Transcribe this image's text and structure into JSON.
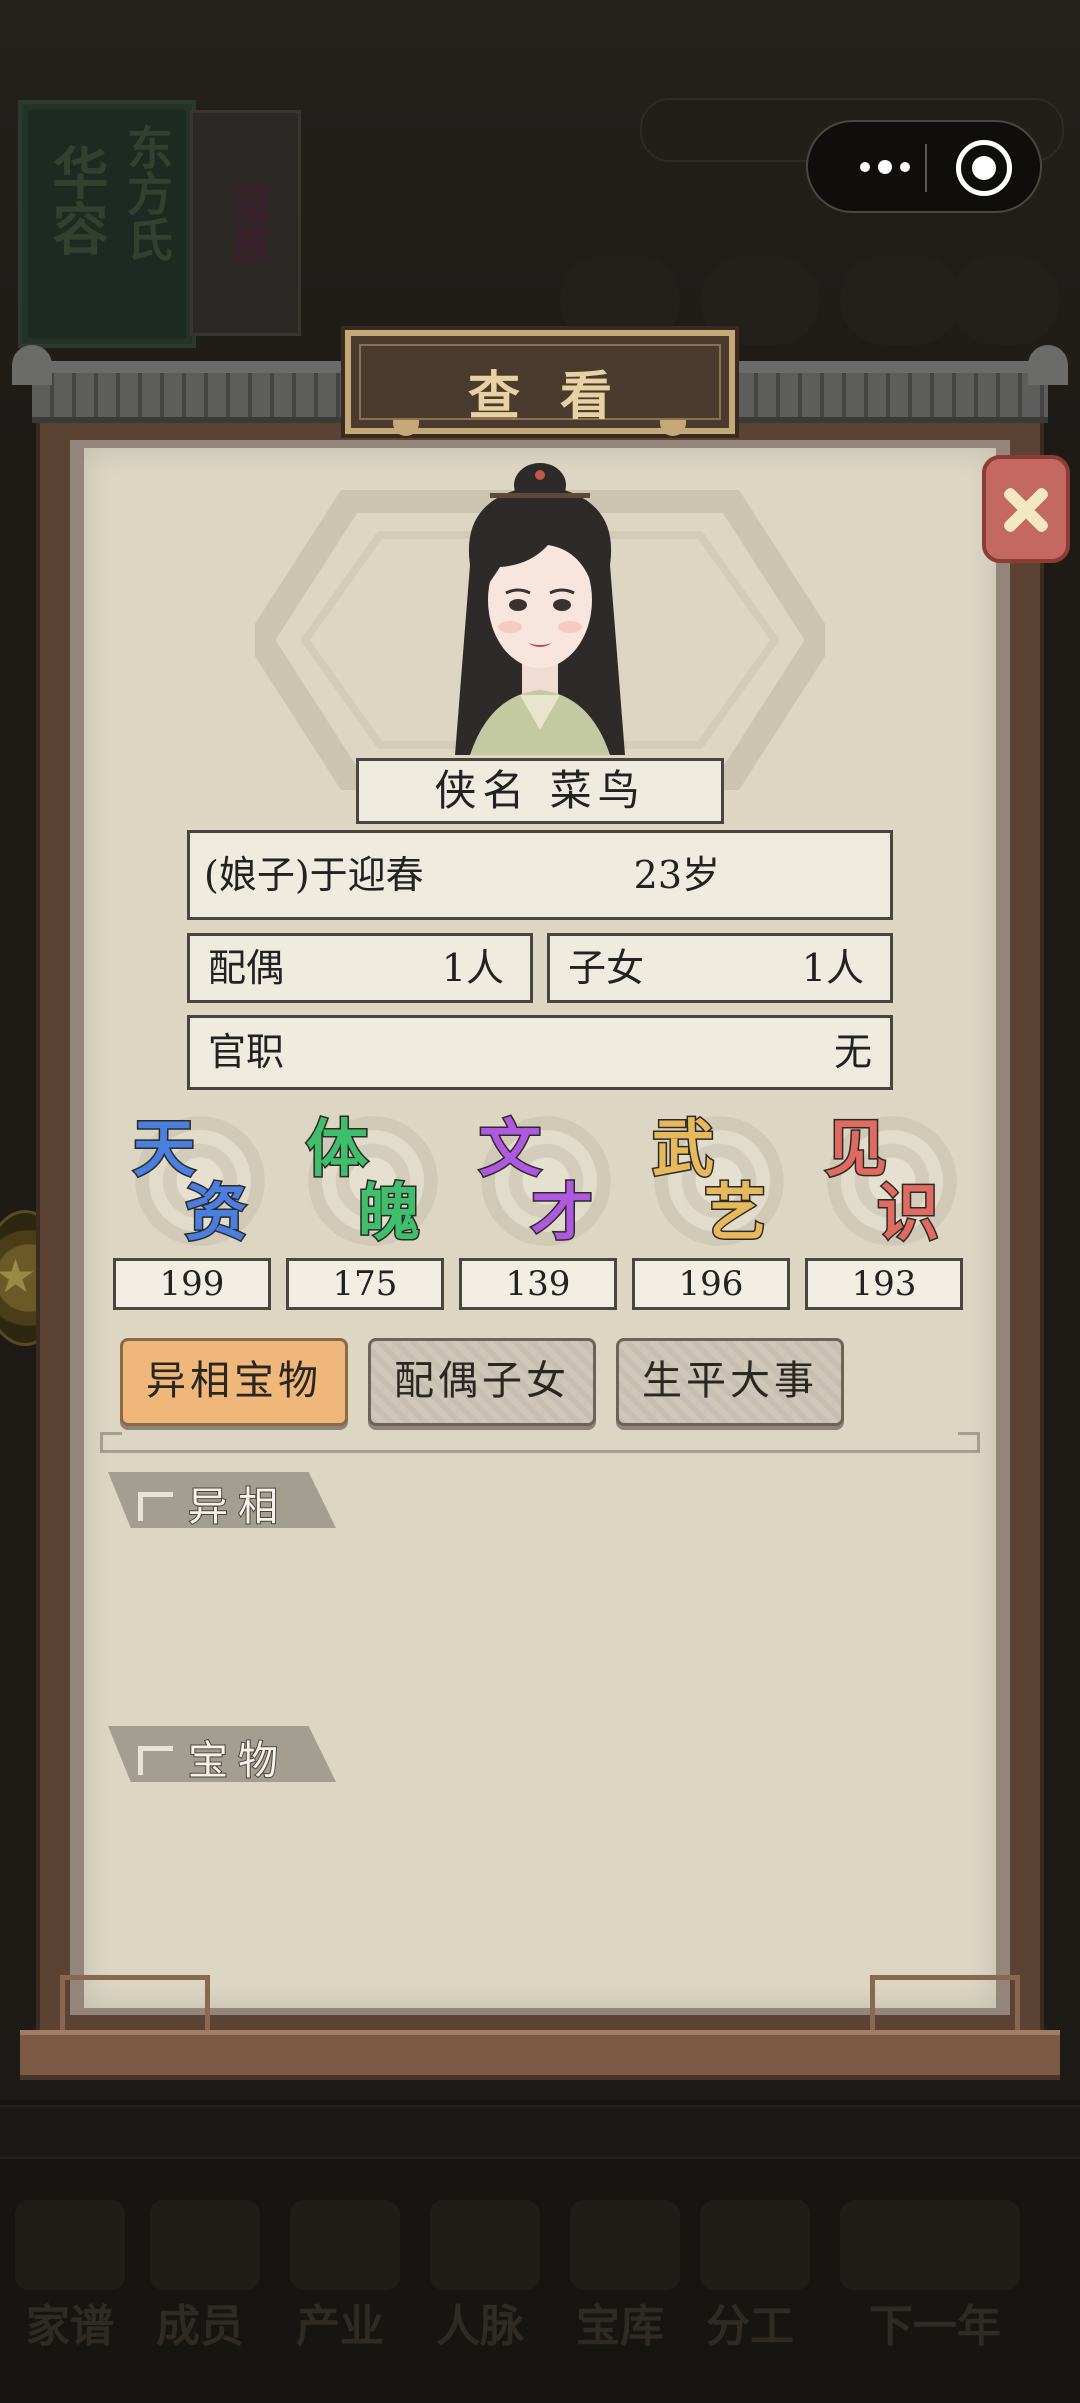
{
  "background": {
    "book_left": [
      "华",
      "容"
    ],
    "book_right": [
      "东",
      "方",
      "氏"
    ],
    "book_side": [
      "望",
      "族"
    ],
    "nav": [
      "家谱",
      "成员",
      "产业",
      "人脉",
      "宝库",
      "分工",
      "下一年"
    ]
  },
  "dialog": {
    "title": "查看",
    "nickname": "侠名 菜鸟",
    "character": {
      "name": "(娘子)于迎春",
      "age": "23岁"
    },
    "spouse": {
      "label": "配偶",
      "value": "1人"
    },
    "children": {
      "label": "子女",
      "value": "1人"
    },
    "office": {
      "label": "官职",
      "value": "无"
    },
    "stats": [
      {
        "c1": "天",
        "c2": "资",
        "value": "199",
        "color": "#4a7fe0"
      },
      {
        "c1": "体",
        "c2": "魄",
        "value": "175",
        "color": "#3fbf6a"
      },
      {
        "c1": "文",
        "c2": "才",
        "value": "139",
        "color": "#b158e0"
      },
      {
        "c1": "武",
        "c2": "艺",
        "value": "196",
        "color": "#e7b95a"
      },
      {
        "c1": "见",
        "c2": "识",
        "value": "193",
        "color": "#e06b5e"
      }
    ],
    "tabs": [
      "异相宝物",
      "配偶子女",
      "生平大事"
    ],
    "active_tab": 0,
    "sections": [
      "异相",
      "宝物"
    ]
  },
  "icons": {
    "close": "close-icon",
    "menu": "more-dots-icon",
    "exit": "target-circle-icon",
    "coin": "star-coin-icon"
  }
}
